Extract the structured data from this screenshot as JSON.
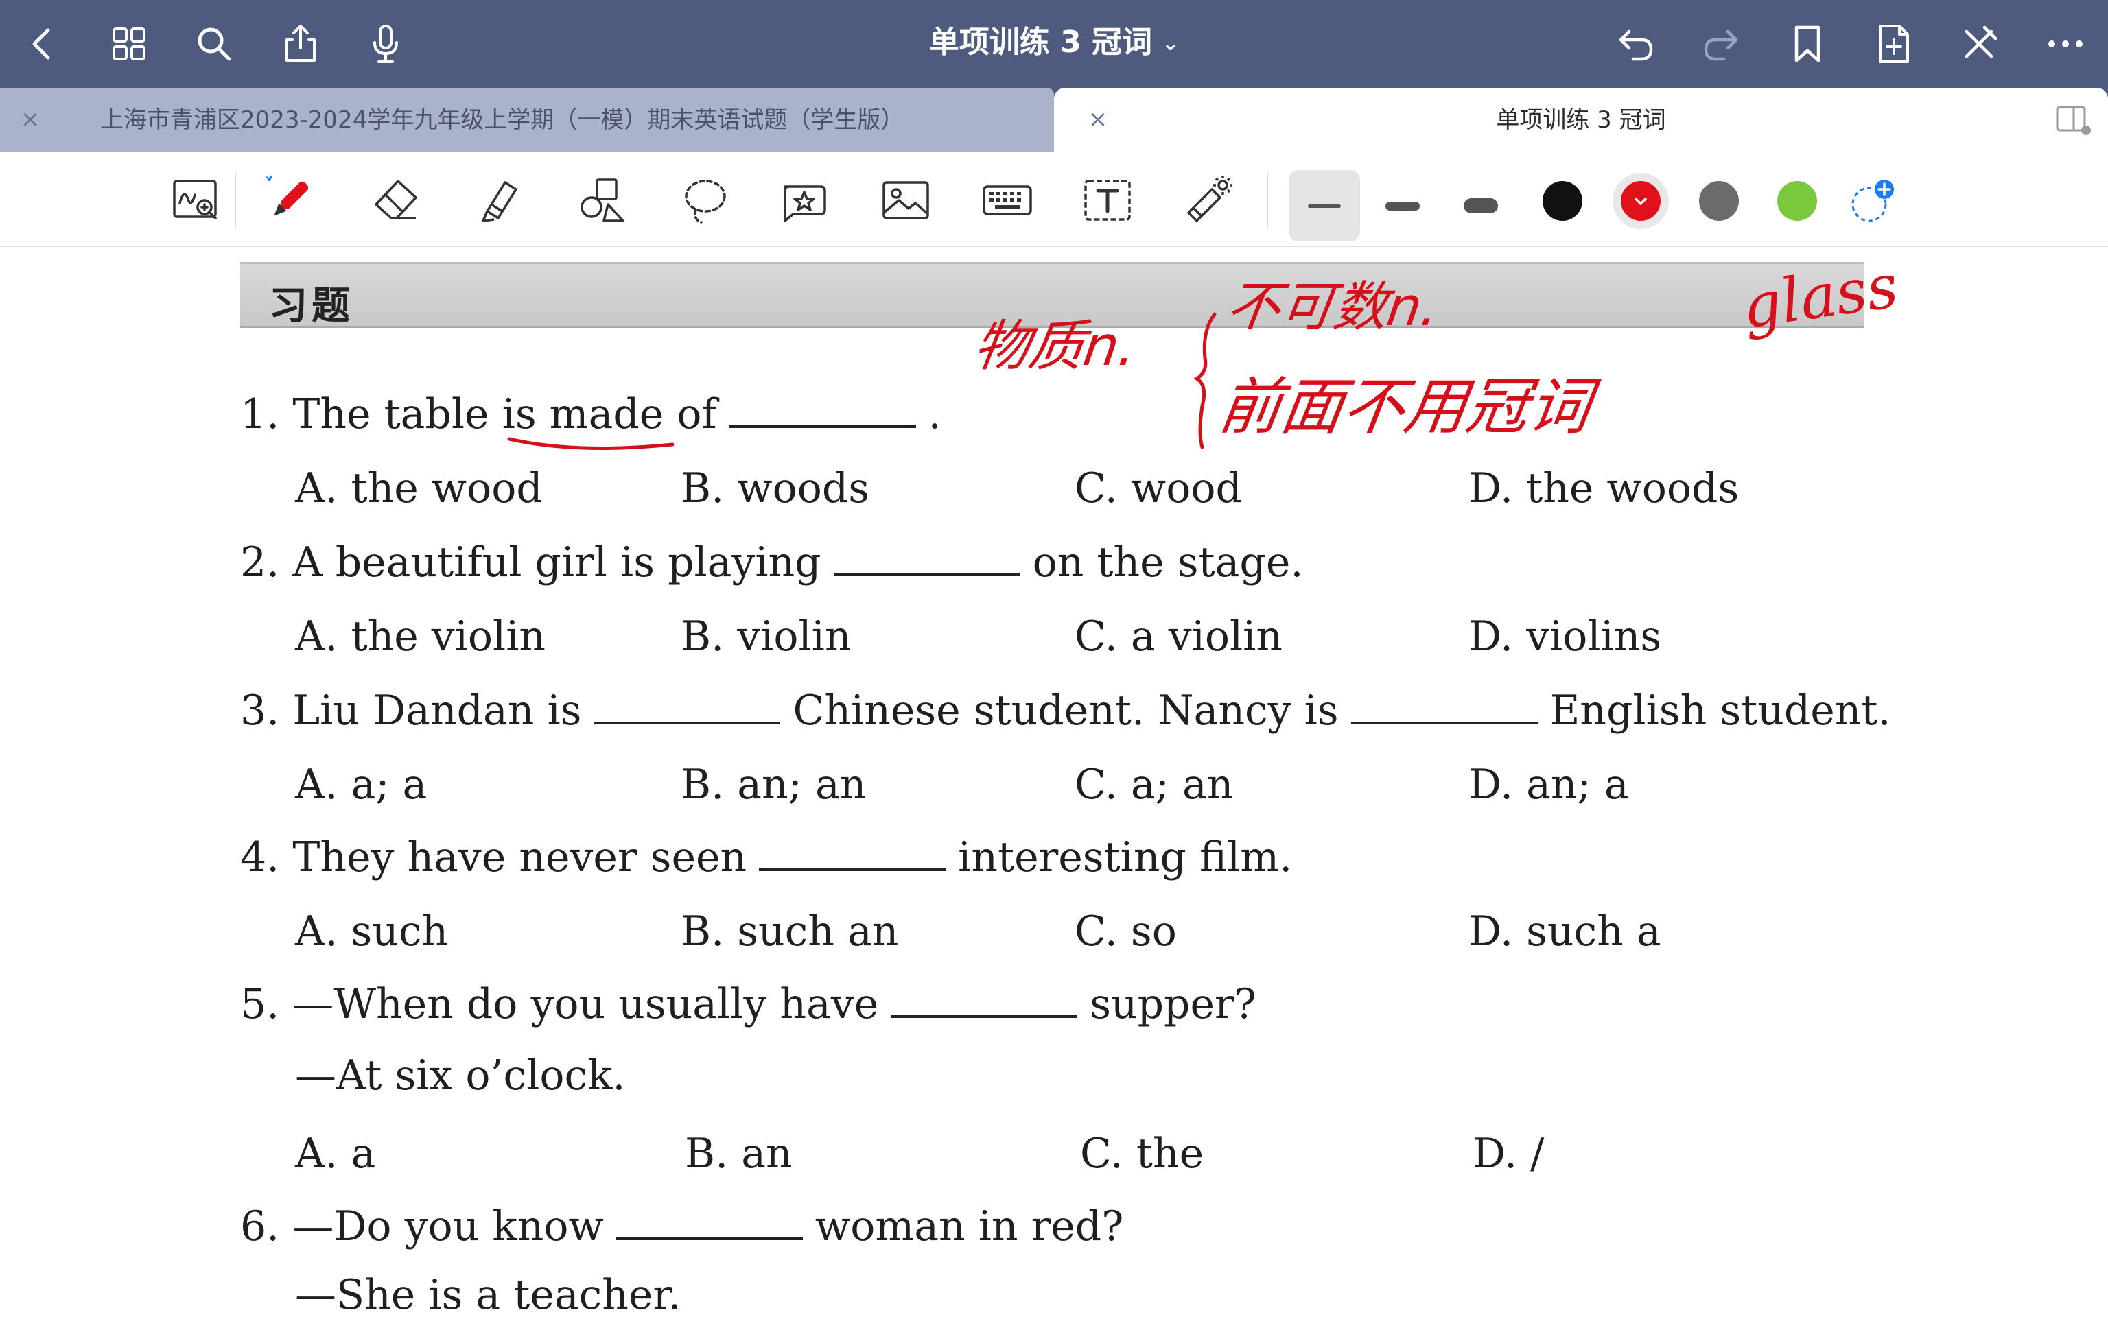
{
  "navbar": {
    "title": "单项训练 3 冠词",
    "icons": [
      "back-icon",
      "grid-icon",
      "search-icon",
      "share-icon",
      "microphone-icon",
      "undo-icon",
      "redo-icon",
      "bookmark-icon",
      "add-page-icon",
      "close-pen-icon",
      "more-icon"
    ]
  },
  "tabs": [
    {
      "label": "上海市青浦区2023-2024学年九年级上学期（一模）期末英语试题（学生版）",
      "active": false
    },
    {
      "label": "单项训练 3 冠词",
      "active": true
    }
  ],
  "toolbar": {
    "tools": [
      "zoom-write",
      "pen",
      "eraser",
      "highlighter",
      "shapes",
      "lasso",
      "sticker",
      "image",
      "keyboard",
      "text",
      "laser-pointer"
    ],
    "strokes": [
      "thin",
      "medium",
      "thick"
    ],
    "colors": [
      "#111111",
      "#e0111b",
      "#6b6b6b",
      "#7ac93c"
    ],
    "selected_color": "#e0111b"
  },
  "doc": {
    "section_title": "习题",
    "questions": [
      {
        "num": "1.",
        "before": "The table is made of",
        "after": ".",
        "options": [
          "A. the wood",
          "B. woods",
          "C. wood",
          "D. the woods"
        ]
      },
      {
        "num": "2.",
        "before": "A beautiful girl is playing",
        "after": "on the stage.",
        "options": [
          "A. the violin",
          "B. violin",
          "C. a violin",
          "D. violins"
        ]
      },
      {
        "num": "3.",
        "before": "Liu Dandan is",
        "middle": "Chinese student. Nancy is",
        "after": "English student.",
        "options": [
          "A. a; a",
          "B. an; an",
          "C. a; an",
          "D. an; a"
        ]
      },
      {
        "num": "4.",
        "before": "They have never seen",
        "after": "interesting film.",
        "options": [
          "A. such",
          "B. such an",
          "C. so",
          "D. such a"
        ]
      },
      {
        "num": "5.",
        "before": "—When do you usually have",
        "after": "supper?",
        "reply": "—At six o’clock.",
        "options": [
          "A. a",
          "B. an",
          "C. the",
          "D. /"
        ]
      },
      {
        "num": "6.",
        "before": "—Do you know",
        "after": "woman in red?",
        "reply": "—She is a teacher."
      }
    ],
    "annotations": {
      "note1": "物质n.",
      "note2": "不可数n.",
      "note3": "前面不用冠词",
      "note4": "glass"
    }
  }
}
